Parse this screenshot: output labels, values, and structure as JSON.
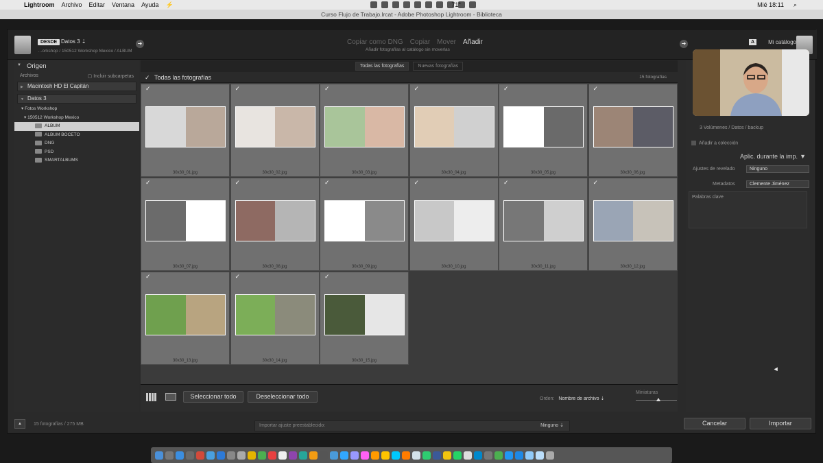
{
  "menubar": {
    "app": "Lightroom",
    "items": [
      "Archivo",
      "Editar",
      "Ventana",
      "Ayuda"
    ],
    "clock": "Mié 18:11",
    "temperature": "71°"
  },
  "window_title": "Curso Flujo de Trabajo.lrcat - Adobe Photoshop Lightroom - Biblioteca",
  "header": {
    "source_badge": "DESDE",
    "source_name": "Datos 3 ⇣",
    "source_path": "…orkshop / 150512 Workshop Mexico / ALBUM",
    "modes": [
      "Copiar como DNG",
      "Copiar",
      "Mover",
      "Añadir"
    ],
    "active_mode": "Añadir",
    "mode_sub": "Añadir fotografías al catálogo sin moverlas",
    "dest_badge": "A",
    "dest_name": "Mi catálogo"
  },
  "left_panel": {
    "title": "Origen",
    "files_label": "Archivos",
    "include_sub": "Incluir subcarpetas",
    "volumes": [
      "Macintosh HD El Capitán",
      "Datos 3"
    ],
    "tree": {
      "parent": "Fotos Workshop",
      "child": "150512 Workshop Mexico",
      "folders": [
        "ALBUM",
        "ALBUM BOCETO",
        "DNG",
        "PSD",
        "SMARTALBUMS"
      ],
      "selected": "ALBUM"
    }
  },
  "center": {
    "tabs": [
      "Todas las fotografías",
      "Nuevas fotografías"
    ],
    "active_tab": "Todas las fotografías",
    "grid_title": "Todas las fotografías",
    "count": "15 fotografías",
    "photos": [
      {
        "name": "30x30_01.jpg",
        "a": "#d8d8d8",
        "b": "#b9a89a"
      },
      {
        "name": "30x30_02.jpg",
        "a": "#e8e4e0",
        "b": "#c9b7a9"
      },
      {
        "name": "30x30_03.jpg",
        "a": "#a9c59a",
        "b": "#d9b8a5"
      },
      {
        "name": "30x30_04.jpg",
        "a": "#e1cdb6",
        "b": "#d0d0d0"
      },
      {
        "name": "30x30_05.jpg",
        "a": "#ffffff",
        "b": "#6a6a6a"
      },
      {
        "name": "30x30_06.jpg",
        "a": "#9c8576",
        "b": "#5c5c66"
      },
      {
        "name": "30x30_07.jpg",
        "a": "#6b6b6b",
        "b": "#ffffff"
      },
      {
        "name": "30x30_08.jpg",
        "a": "#8e6a62",
        "b": "#b5b5b5"
      },
      {
        "name": "30x30_09.jpg",
        "a": "#ffffff",
        "b": "#8a8a8a"
      },
      {
        "name": "30x30_10.jpg",
        "a": "#c8c8c8",
        "b": "#ededed"
      },
      {
        "name": "30x30_11.jpg",
        "a": "#777777",
        "b": "#cfcfcf"
      },
      {
        "name": "30x30_12.jpg",
        "a": "#9aa5b5",
        "b": "#c7c2b9"
      },
      {
        "name": "30x30_13.jpg",
        "a": "#6fa04e",
        "b": "#b8a480"
      },
      {
        "name": "30x30_14.jpg",
        "a": "#7cae58",
        "b": "#8b8b7b"
      },
      {
        "name": "30x30_15.jpg",
        "a": "#4a5a3a",
        "b": "#e6e6e6"
      }
    ],
    "select_all": "Seleccionar todo",
    "deselect_all": "Deseleccionar todo",
    "sort_label": "Orden:",
    "sort_value": "Nombre de archivo ⇣",
    "thumbs_label": "Miniaturas"
  },
  "right_panel": {
    "add_to_collection": "Añadir a colección",
    "path_hint": "3 Volúmenes / Datos / backup",
    "section_title": "Aplic. durante la imp.",
    "develop_label": "Ajustes de revelado",
    "develop_value": "Ninguno",
    "metadata_label": "Metadatos",
    "metadata_value": "Clemente Jiménez",
    "keywords_label": "Palabras clave"
  },
  "footer": {
    "info": "15 fotografías / 275 MB",
    "preset_label": "Importar ajuste preestablecido:",
    "preset_value": "Ninguno ⇣",
    "cancel": "Cancelar",
    "import": "Importar"
  }
}
